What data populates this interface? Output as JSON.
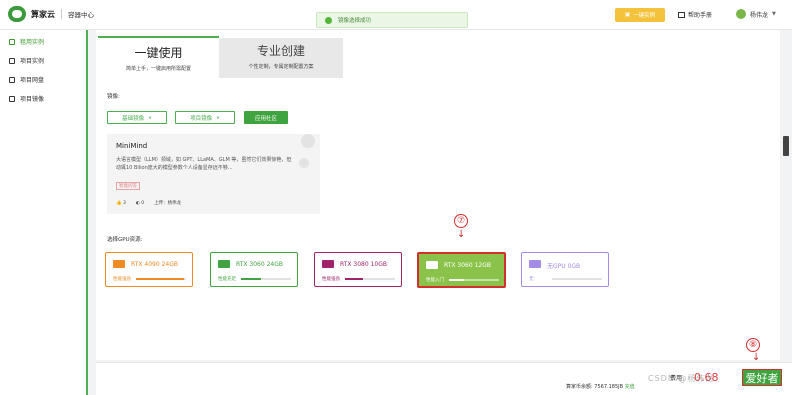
{
  "header": {
    "logo_text": "算家云",
    "logo_sub": "容器中心",
    "toast": "镜像选择成功",
    "onekey_btn": "一键实例",
    "help": "帮助手册",
    "user": "杨伟龙"
  },
  "sidebar": {
    "items": [
      {
        "label": "租用实例"
      },
      {
        "label": "项目实例"
      },
      {
        "label": "项目网盘"
      },
      {
        "label": "项目镜像"
      }
    ]
  },
  "tabs": [
    {
      "title": "一键使用",
      "subtitle": "简单上手，一键启用所需配置"
    },
    {
      "title": "专业创建",
      "subtitle": "个性定制，专属定制配置方案"
    }
  ],
  "mirror": {
    "label": "镜像:",
    "buttons": [
      "基础镜像",
      "项目镜像",
      "应用社区"
    ]
  },
  "card": {
    "title": "MiniMind",
    "desc": "大语言模型（LLM）领域，如 GPT、LLaMA、GLM 等，虽然它们效果惊艳，但动辄10 Bilion庞大的模型参数个人设备显存远不够...",
    "tag": "智能问答",
    "likes": "3",
    "views": "0",
    "uploader": "上传：杨伟龙"
  },
  "gpu": {
    "label": "选择GPU资源:",
    "options": [
      {
        "name": "RTX 4090  24GB",
        "sub": "性能强劲",
        "color": "#f08a24",
        "level": 0.95
      },
      {
        "name": "RTX 3060  24GB",
        "sub": "性能充足",
        "color": "#3fa43f",
        "level": 0.4
      },
      {
        "name": "RTX 3080  10GB",
        "sub": "性能强劲",
        "color": "#a0236a",
        "level": 0.35
      },
      {
        "name": "RTX 3060  12GB",
        "sub": "性能入门",
        "color": "#8bc34a",
        "level": 0.3
      },
      {
        "name": "无GPU        0GB",
        "sub": "无",
        "color": "#a58be8",
        "level": 0
      }
    ]
  },
  "annotations": {
    "seven": "⑦",
    "eight": "⑧"
  },
  "footer": {
    "balance": "算家币余额:  7567.185JB",
    "recharge": "充值",
    "price_label": "费用",
    "price": "0.68",
    "submit": "爱好者"
  },
  "watermark": "CSDN @杨伟龙"
}
